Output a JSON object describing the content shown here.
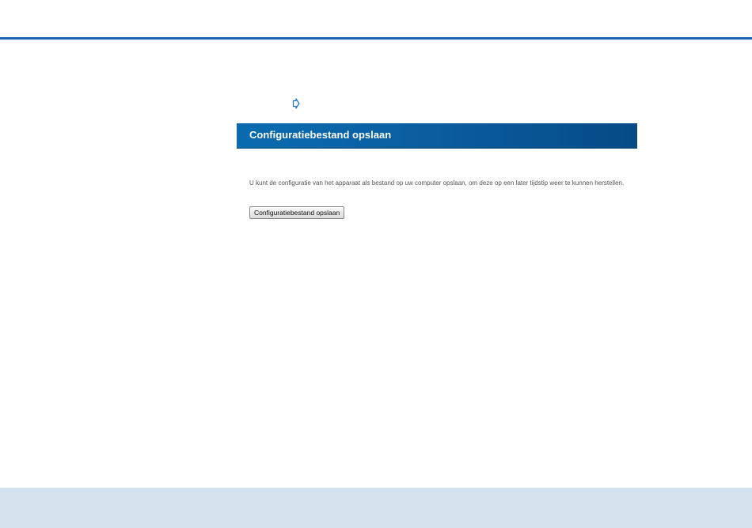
{
  "panel": {
    "title": "Configuratiebestand opslaan",
    "description": "U kunt de configuratie van het apparaat als bestand op uw computer opslaan, om deze op een later tijdstip weer te kunnen herstellen.",
    "button_label": "Configuratiebestand opslaan"
  },
  "icons": {
    "marker": "arrow-right-outline-icon"
  },
  "colors": {
    "rule": "#1f5fb5",
    "header_start": "#0a6bb0",
    "header_end": "#054a86",
    "footer": "#d5e3ef",
    "marker": "#1a6fd0"
  }
}
